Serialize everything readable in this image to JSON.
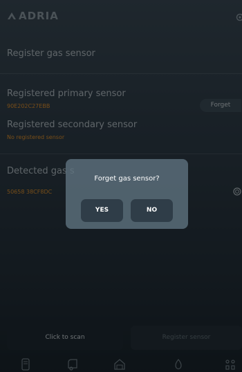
{
  "header": {
    "brand": "ADRIA",
    "logo_icon": "adria-logo-icon",
    "settings_icon": "gear-icon"
  },
  "register": {
    "title": "Register gas sensor"
  },
  "primary": {
    "title": "Registered primary sensor",
    "id": "90E202C27EBB",
    "forget_label": "Forget"
  },
  "secondary": {
    "title": "Registered secondary sensor",
    "status": "No registered sensor"
  },
  "detected": {
    "title": "Detected gas s",
    "id": "50658 38CF8DC",
    "select_icon": "radio-icon"
  },
  "actions": {
    "scan_label": "Click to scan",
    "register_label": "Register sensor"
  },
  "nav": {
    "items": [
      {
        "icon": "phone-icon"
      },
      {
        "icon": "caravan-icon"
      },
      {
        "icon": "garage-icon"
      },
      {
        "icon": "water-drop-icon"
      },
      {
        "icon": "controls-icon"
      }
    ]
  },
  "dialog": {
    "title": "Forget gas sensor?",
    "yes_label": "YES",
    "no_label": "NO"
  },
  "colors": {
    "accent": "#ff9a1f",
    "dialog_bg": "#607482",
    "button_bg": "#2f3d48"
  }
}
